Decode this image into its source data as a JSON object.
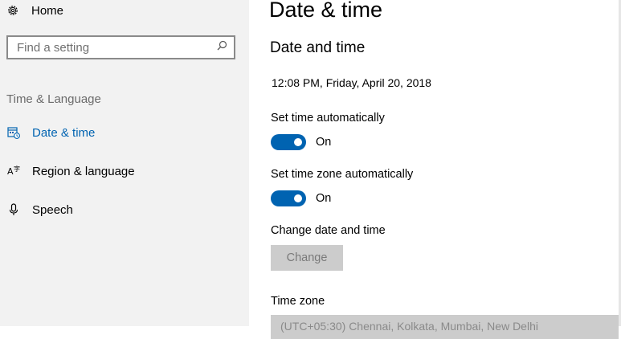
{
  "sidebar": {
    "home": {
      "label": "Home",
      "icon": "gear-icon"
    },
    "search": {
      "placeholder": "Find a setting",
      "icon": "search-icon"
    },
    "section_label": "Time & Language",
    "items": [
      {
        "label": "Date & time",
        "icon": "calendar-clock-icon",
        "active": true
      },
      {
        "label": "Region & language",
        "icon": "language-icon",
        "active": false
      },
      {
        "label": "Speech",
        "icon": "microphone-icon",
        "active": false
      }
    ]
  },
  "main": {
    "title": "Date & time",
    "subheading": "Date and time",
    "current_datetime": "12:08 PM, Friday, April 20, 2018",
    "set_time_auto": {
      "label": "Set time automatically",
      "state": "On"
    },
    "set_tz_auto": {
      "label": "Set time zone automatically",
      "state": "On"
    },
    "change_section": {
      "label": "Change date and time",
      "button": "Change"
    },
    "time_zone": {
      "label": "Time zone",
      "value": "(UTC+05:30) Chennai, Kolkata, Mumbai, New Delhi"
    }
  },
  "colors": {
    "accent": "#0063b1",
    "sidebar_bg": "#f2f2f2",
    "disabled_bg": "#cccccc"
  }
}
